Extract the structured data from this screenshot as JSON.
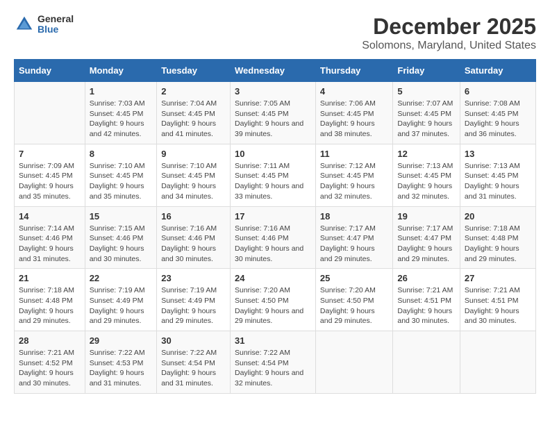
{
  "header": {
    "logo_general": "General",
    "logo_blue": "Blue",
    "title": "December 2025",
    "subtitle": "Solomons, Maryland, United States"
  },
  "calendar": {
    "headers": [
      "Sunday",
      "Monday",
      "Tuesday",
      "Wednesday",
      "Thursday",
      "Friday",
      "Saturday"
    ],
    "rows": [
      [
        {
          "day": "",
          "detail": ""
        },
        {
          "day": "1",
          "detail": "Sunrise: 7:03 AM\nSunset: 4:45 PM\nDaylight: 9 hours\nand 42 minutes."
        },
        {
          "day": "2",
          "detail": "Sunrise: 7:04 AM\nSunset: 4:45 PM\nDaylight: 9 hours\nand 41 minutes."
        },
        {
          "day": "3",
          "detail": "Sunrise: 7:05 AM\nSunset: 4:45 PM\nDaylight: 9 hours\nand 39 minutes."
        },
        {
          "day": "4",
          "detail": "Sunrise: 7:06 AM\nSunset: 4:45 PM\nDaylight: 9 hours\nand 38 minutes."
        },
        {
          "day": "5",
          "detail": "Sunrise: 7:07 AM\nSunset: 4:45 PM\nDaylight: 9 hours\nand 37 minutes."
        },
        {
          "day": "6",
          "detail": "Sunrise: 7:08 AM\nSunset: 4:45 PM\nDaylight: 9 hours\nand 36 minutes."
        }
      ],
      [
        {
          "day": "7",
          "detail": "Sunrise: 7:09 AM\nSunset: 4:45 PM\nDaylight: 9 hours\nand 35 minutes."
        },
        {
          "day": "8",
          "detail": "Sunrise: 7:10 AM\nSunset: 4:45 PM\nDaylight: 9 hours\nand 35 minutes."
        },
        {
          "day": "9",
          "detail": "Sunrise: 7:10 AM\nSunset: 4:45 PM\nDaylight: 9 hours\nand 34 minutes."
        },
        {
          "day": "10",
          "detail": "Sunrise: 7:11 AM\nSunset: 4:45 PM\nDaylight: 9 hours\nand 33 minutes."
        },
        {
          "day": "11",
          "detail": "Sunrise: 7:12 AM\nSunset: 4:45 PM\nDaylight: 9 hours\nand 32 minutes."
        },
        {
          "day": "12",
          "detail": "Sunrise: 7:13 AM\nSunset: 4:45 PM\nDaylight: 9 hours\nand 32 minutes."
        },
        {
          "day": "13",
          "detail": "Sunrise: 7:13 AM\nSunset: 4:45 PM\nDaylight: 9 hours\nand 31 minutes."
        }
      ],
      [
        {
          "day": "14",
          "detail": "Sunrise: 7:14 AM\nSunset: 4:46 PM\nDaylight: 9 hours\nand 31 minutes."
        },
        {
          "day": "15",
          "detail": "Sunrise: 7:15 AM\nSunset: 4:46 PM\nDaylight: 9 hours\nand 30 minutes."
        },
        {
          "day": "16",
          "detail": "Sunrise: 7:16 AM\nSunset: 4:46 PM\nDaylight: 9 hours\nand 30 minutes."
        },
        {
          "day": "17",
          "detail": "Sunrise: 7:16 AM\nSunset: 4:46 PM\nDaylight: 9 hours\nand 30 minutes."
        },
        {
          "day": "18",
          "detail": "Sunrise: 7:17 AM\nSunset: 4:47 PM\nDaylight: 9 hours\nand 29 minutes."
        },
        {
          "day": "19",
          "detail": "Sunrise: 7:17 AM\nSunset: 4:47 PM\nDaylight: 9 hours\nand 29 minutes."
        },
        {
          "day": "20",
          "detail": "Sunrise: 7:18 AM\nSunset: 4:48 PM\nDaylight: 9 hours\nand 29 minutes."
        }
      ],
      [
        {
          "day": "21",
          "detail": "Sunrise: 7:18 AM\nSunset: 4:48 PM\nDaylight: 9 hours\nand 29 minutes."
        },
        {
          "day": "22",
          "detail": "Sunrise: 7:19 AM\nSunset: 4:49 PM\nDaylight: 9 hours\nand 29 minutes."
        },
        {
          "day": "23",
          "detail": "Sunrise: 7:19 AM\nSunset: 4:49 PM\nDaylight: 9 hours\nand 29 minutes."
        },
        {
          "day": "24",
          "detail": "Sunrise: 7:20 AM\nSunset: 4:50 PM\nDaylight: 9 hours\nand 29 minutes."
        },
        {
          "day": "25",
          "detail": "Sunrise: 7:20 AM\nSunset: 4:50 PM\nDaylight: 9 hours\nand 29 minutes."
        },
        {
          "day": "26",
          "detail": "Sunrise: 7:21 AM\nSunset: 4:51 PM\nDaylight: 9 hours\nand 30 minutes."
        },
        {
          "day": "27",
          "detail": "Sunrise: 7:21 AM\nSunset: 4:51 PM\nDaylight: 9 hours\nand 30 minutes."
        }
      ],
      [
        {
          "day": "28",
          "detail": "Sunrise: 7:21 AM\nSunset: 4:52 PM\nDaylight: 9 hours\nand 30 minutes."
        },
        {
          "day": "29",
          "detail": "Sunrise: 7:22 AM\nSunset: 4:53 PM\nDaylight: 9 hours\nand 31 minutes."
        },
        {
          "day": "30",
          "detail": "Sunrise: 7:22 AM\nSunset: 4:54 PM\nDaylight: 9 hours\nand 31 minutes."
        },
        {
          "day": "31",
          "detail": "Sunrise: 7:22 AM\nSunset: 4:54 PM\nDaylight: 9 hours\nand 32 minutes."
        },
        {
          "day": "",
          "detail": ""
        },
        {
          "day": "",
          "detail": ""
        },
        {
          "day": "",
          "detail": ""
        }
      ]
    ]
  }
}
